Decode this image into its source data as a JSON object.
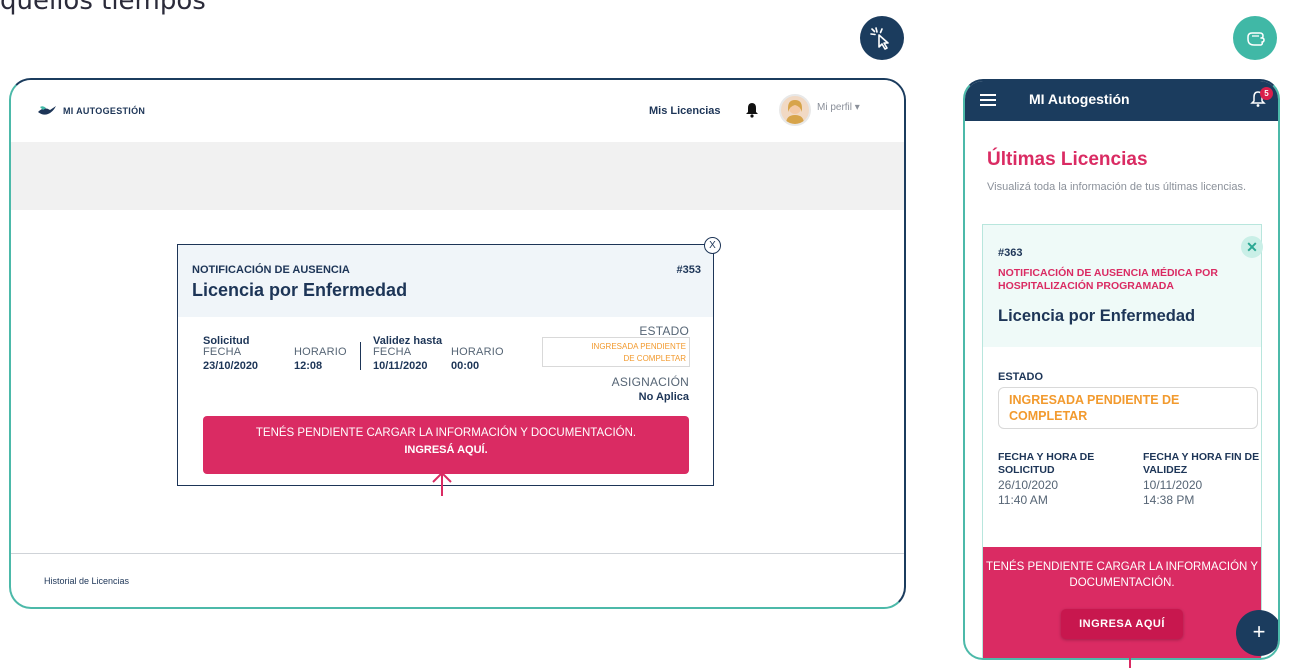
{
  "caption": "quellos tiempos",
  "desktop": {
    "logo_text": "MI AUTOGESTIÓN",
    "nav_link": "Mis Licencias",
    "profile_label": "Mi perfil",
    "footer_link": "Historial de Licencias",
    "card": {
      "type": "NOTIFICACIÓN DE AUSENCIA",
      "title": "Licencia por Enfermedad",
      "number": "#353",
      "close": "X",
      "solicitud_label": "Solicitud",
      "validez_label": "Validez hasta",
      "fecha_label": "FECHA",
      "horario_label": "HORARIO",
      "solicitud_fecha": "23/10/2020",
      "solicitud_horario": "12:08",
      "validez_fecha": "10/11/2020",
      "validez_horario": "00:00",
      "estado_label": "ESTADO",
      "estado_line1": "INGRESADA PENDIENTE",
      "estado_line2": "DE COMPLETAR",
      "asignacion_label": "ASIGNACIÓN",
      "asignacion_value": "No Aplica",
      "cta_line1": "TENÉS PENDIENTE CARGAR LA INFORMACIÓN Y DOCUMENTACIÓN.",
      "cta_line2": "INGRESÁ AQUÍ."
    }
  },
  "mobile": {
    "app_title": "MI Autogestión",
    "notification_count": "5",
    "heading": "Últimas Licencias",
    "subheading": "Visualizá toda la información de tus últimas licencias.",
    "card": {
      "number": "#363",
      "type": "NOTIFICACIÓN DE AUSENCIA MÉDICA POR HOSPITALIZACIÓN PROGRAMADA",
      "title": "Licencia por Enfermedad",
      "estado_label": "ESTADO",
      "estado_value": "INGRESADA PENDIENTE DE COMPLETAR",
      "solicitud_label": "FECHA Y HORA DE SOLICITUD",
      "solicitud_date": "26/10/2020",
      "solicitud_time": "11:40 AM",
      "validez_label": "FECHA Y HORA FIN DE VALIDEZ",
      "validez_date": "10/11/2020",
      "validez_time": "14:38 PM",
      "cta_text": "TENÉS PENDIENTE CARGAR LA INFORMACIÓN Y DOCUMENTACIÓN.",
      "cta_button": "INGRESA AQUÍ"
    },
    "fab": "+"
  },
  "colors": {
    "navy": "#1b3c5e",
    "teal": "#40b8a6",
    "magenta": "#da2b63",
    "orange": "#f29a2e"
  },
  "icons": [
    "cursor-click-icon",
    "touch-tap-icon",
    "logo-bird-icon",
    "bell-icon",
    "avatar",
    "caret-down-icon",
    "close-icon",
    "hamburger-menu-icon",
    "up-arrow-icon",
    "plus-icon"
  ]
}
